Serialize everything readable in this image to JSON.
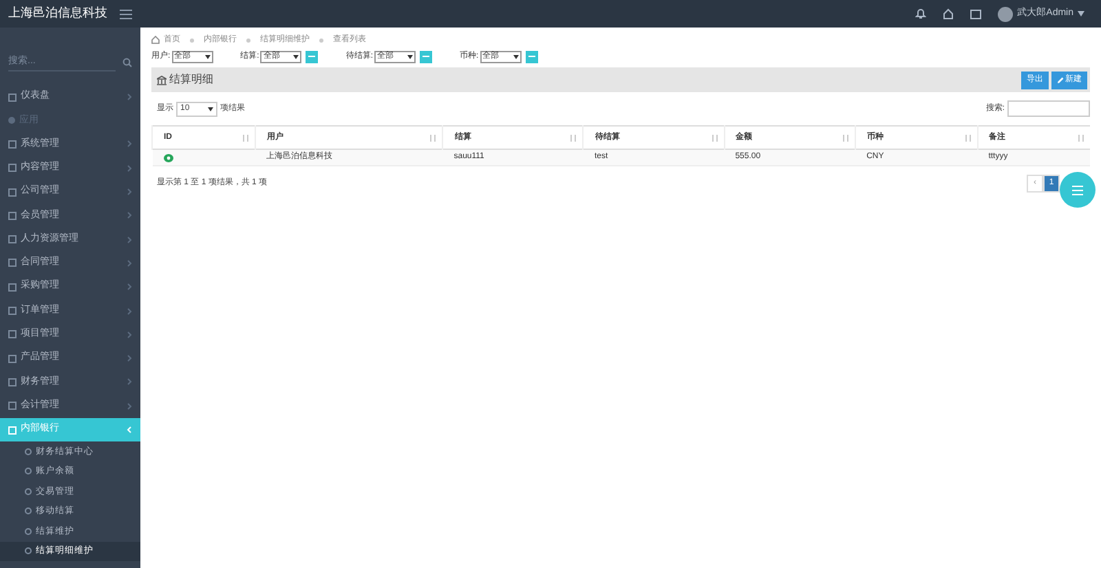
{
  "brand": "上海邑泊信息科技",
  "user": {
    "name": "武大郎Admin"
  },
  "sidebar": {
    "search_placeholder": "搜索...",
    "items": [
      {
        "label": "仪表盘",
        "kind": "item",
        "selected": false
      },
      {
        "label": "应用",
        "kind": "heading"
      },
      {
        "label": "系统管理",
        "kind": "item",
        "selected": false
      },
      {
        "label": "内容管理",
        "kind": "item",
        "selected": false
      },
      {
        "label": "公司管理",
        "kind": "item",
        "selected": false
      },
      {
        "label": "会员管理",
        "kind": "item",
        "selected": false
      },
      {
        "label": "人力资源管理",
        "kind": "item",
        "selected": false
      },
      {
        "label": "合同管理",
        "kind": "item",
        "selected": false
      },
      {
        "label": "采购管理",
        "kind": "item",
        "selected": false
      },
      {
        "label": "订单管理",
        "kind": "item",
        "selected": false
      },
      {
        "label": "项目管理",
        "kind": "item",
        "selected": false
      },
      {
        "label": "产品管理",
        "kind": "item",
        "selected": false
      },
      {
        "label": "财务管理",
        "kind": "item",
        "selected": false
      },
      {
        "label": "会计管理",
        "kind": "item",
        "selected": false
      },
      {
        "label": "内部银行",
        "kind": "item",
        "selected": true,
        "children": [
          {
            "label": "财务结算中心",
            "selected": false
          },
          {
            "label": "账户余额",
            "selected": false
          },
          {
            "label": "交易管理",
            "selected": false
          },
          {
            "label": "移动结算",
            "selected": false
          },
          {
            "label": "结算维护",
            "selected": false
          },
          {
            "label": "结算明细维护",
            "selected": true
          }
        ]
      }
    ]
  },
  "breadcrumb": [
    "首页",
    "内部银行",
    "结算明细维护",
    "查看列表"
  ],
  "filters": [
    {
      "label": "用户:",
      "value": "全部",
      "kind": "select"
    },
    {
      "label": "结算:",
      "value": "全部",
      "kind": "picker"
    },
    {
      "label": "待结算:",
      "value": "全部",
      "kind": "picker"
    },
    {
      "label": "币种:",
      "value": "全部",
      "kind": "picker"
    }
  ],
  "panel": {
    "title": "结算明细",
    "buttons": [
      "导出",
      "新建"
    ]
  },
  "length": {
    "before": "显示",
    "value": "10",
    "after": "项结果"
  },
  "search": {
    "label": "搜索:"
  },
  "table": {
    "columns": [
      "ID",
      "用户",
      "结算",
      "待结算",
      "金额",
      "币种",
      "备注"
    ],
    "rows": [
      [
        "",
        "上海邑泊信息科技",
        "sauu111",
        "test",
        "555.00",
        "CNY",
        "tttyyy"
      ]
    ]
  },
  "info": "显示第 1 至 1 项结果，共 1 项",
  "pagination": [
    {
      "label": "‹",
      "selected": false
    },
    {
      "label": "1",
      "selected": true
    }
  ]
}
